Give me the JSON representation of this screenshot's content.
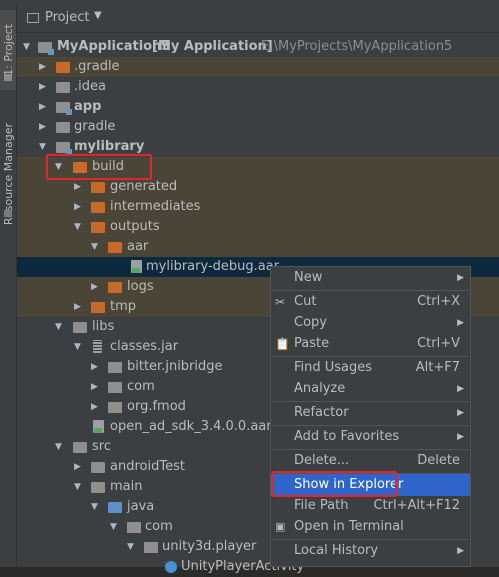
{
  "left_strip": {
    "project_tab": "1: Project",
    "resource_tab": "Resource Manager"
  },
  "panel": {
    "title": "Project"
  },
  "tree": {
    "root_name": "MyApplication5",
    "root_tag": "[My Application]",
    "root_path": "E:\\MyProjects\\MyApplication5",
    "gradle_hidden": ".gradle",
    "idea": ".idea",
    "app": "app",
    "gradle": "gradle",
    "mylibrary": "mylibrary",
    "build": "build",
    "generated": "generated",
    "intermediates": "intermediates",
    "outputs": "outputs",
    "aar": "aar",
    "aar_file": "mylibrary-debug.aar",
    "logs": "logs",
    "tmp": "tmp",
    "libs": "libs",
    "classes_jar": "classes.jar",
    "bitter": "bitter.jnibridge",
    "com_pkg": "com",
    "fmod": "org.fmod",
    "open_ad": "open_ad_sdk_3.4.0.0.aar",
    "src": "src",
    "android_test": "androidTest",
    "main": "main",
    "java": "java",
    "com": "com",
    "unity3d": "unity3d.player",
    "unity_activity": "UnityPlayerActivity"
  },
  "context_menu": {
    "new": "New",
    "cut": "Cut",
    "cut_shortcut": "Ctrl+X",
    "copy": "Copy",
    "paste": "Paste",
    "paste_shortcut": "Ctrl+V",
    "find_usages": "Find Usages",
    "find_usages_shortcut": "Alt+F7",
    "analyze": "Analyze",
    "refactor": "Refactor",
    "add_to_favorites": "Add to Favorites",
    "delete": "Delete...",
    "delete_shortcut": "Delete",
    "show_in_explorer": "Show in Explorer",
    "file_path": "File Path",
    "file_path_shortcut": "Ctrl+Alt+F12",
    "open_in_terminal": "Open in Terminal",
    "local_history": "Local History"
  },
  "colors": {
    "highlight_row": "#4a4536",
    "selected_row": "#0d293e",
    "menu_active": "#2f65ca",
    "annotation_red": "#e0262b"
  }
}
